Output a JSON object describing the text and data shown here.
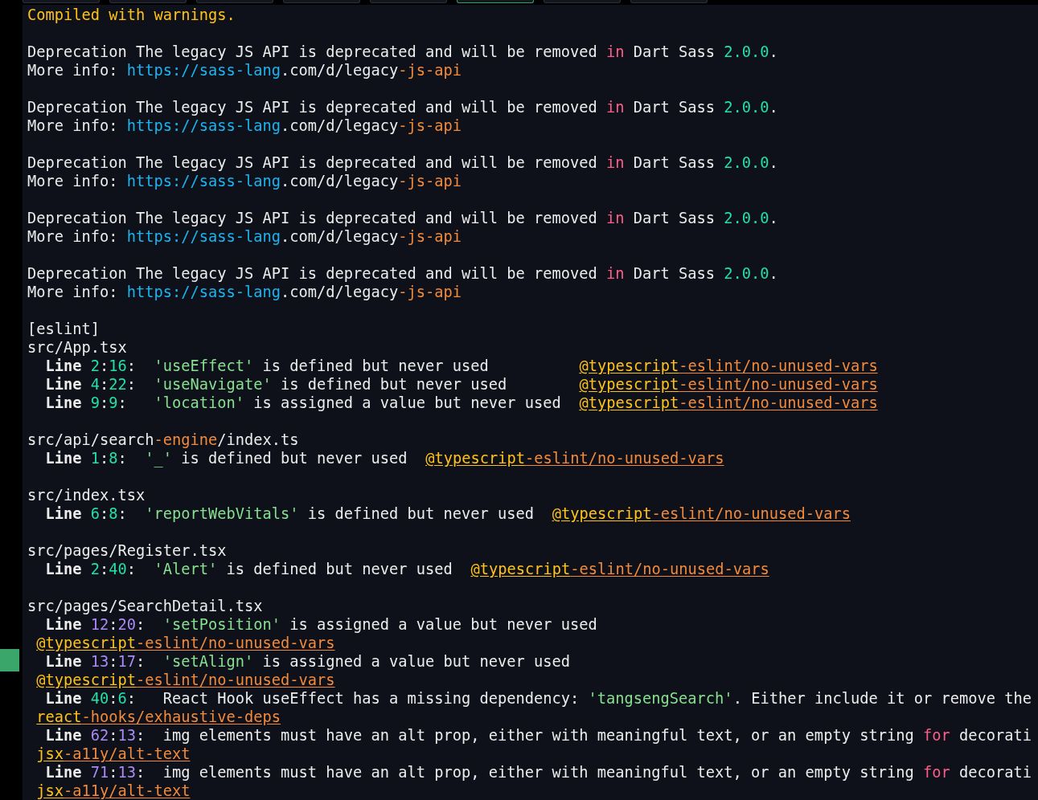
{
  "tabs": [
    {
      "selected": false
    },
    {
      "selected": false
    },
    {
      "selected": false
    },
    {
      "selected": false
    },
    {
      "selected": false
    },
    {
      "selected": true
    },
    {
      "selected": false
    },
    {
      "selected": false
    }
  ],
  "terminal": {
    "lines": [
      {
        "kind": "status",
        "segments": [
          {
            "kind": "warning",
            "text": "Compiled with warnings."
          }
        ]
      },
      {
        "kind": "blank"
      },
      {
        "kind": "log",
        "segments": [
          {
            "kind": "text",
            "text": "Deprecation The legacy JS API is deprecated and will be removed "
          },
          {
            "kind": "keyword",
            "text": "in"
          },
          {
            "kind": "text",
            "text": " Dart Sass "
          },
          {
            "kind": "number",
            "text": "2.0.0"
          },
          {
            "kind": "text",
            "text": "."
          }
        ]
      },
      {
        "kind": "log",
        "segments": [
          {
            "kind": "text",
            "text": "More info: "
          },
          {
            "kind": "url",
            "text": "https://sass-lang"
          },
          {
            "kind": "text",
            "text": ".com/d/legacy"
          },
          {
            "kind": "suffix",
            "text": "-js-api"
          }
        ]
      },
      {
        "kind": "blank"
      },
      {
        "kind": "log",
        "segments": [
          {
            "kind": "text",
            "text": "Deprecation The legacy JS API is deprecated and will be removed "
          },
          {
            "kind": "keyword",
            "text": "in"
          },
          {
            "kind": "text",
            "text": " Dart Sass "
          },
          {
            "kind": "number",
            "text": "2.0.0"
          },
          {
            "kind": "text",
            "text": "."
          }
        ]
      },
      {
        "kind": "log",
        "segments": [
          {
            "kind": "text",
            "text": "More info: "
          },
          {
            "kind": "url",
            "text": "https://sass-lang"
          },
          {
            "kind": "text",
            "text": ".com/d/legacy"
          },
          {
            "kind": "suffix",
            "text": "-js-api"
          }
        ]
      },
      {
        "kind": "blank"
      },
      {
        "kind": "log",
        "segments": [
          {
            "kind": "text",
            "text": "Deprecation The legacy JS API is deprecated and will be removed "
          },
          {
            "kind": "keyword",
            "text": "in"
          },
          {
            "kind": "text",
            "text": " Dart Sass "
          },
          {
            "kind": "number",
            "text": "2.0.0"
          },
          {
            "kind": "text",
            "text": "."
          }
        ]
      },
      {
        "kind": "log",
        "segments": [
          {
            "kind": "text",
            "text": "More info: "
          },
          {
            "kind": "url",
            "text": "https://sass-lang"
          },
          {
            "kind": "text",
            "text": ".com/d/legacy"
          },
          {
            "kind": "suffix",
            "text": "-js-api"
          }
        ]
      },
      {
        "kind": "blank"
      },
      {
        "kind": "log",
        "segments": [
          {
            "kind": "text",
            "text": "Deprecation The legacy JS API is deprecated and will be removed "
          },
          {
            "kind": "keyword",
            "text": "in"
          },
          {
            "kind": "text",
            "text": " Dart Sass "
          },
          {
            "kind": "number",
            "text": "2.0.0"
          },
          {
            "kind": "text",
            "text": "."
          }
        ]
      },
      {
        "kind": "log",
        "segments": [
          {
            "kind": "text",
            "text": "More info: "
          },
          {
            "kind": "url",
            "text": "https://sass-lang"
          },
          {
            "kind": "text",
            "text": ".com/d/legacy"
          },
          {
            "kind": "suffix",
            "text": "-js-api"
          }
        ]
      },
      {
        "kind": "blank"
      },
      {
        "kind": "log",
        "segments": [
          {
            "kind": "text",
            "text": "Deprecation The legacy JS API is deprecated and will be removed "
          },
          {
            "kind": "keyword",
            "text": "in"
          },
          {
            "kind": "text",
            "text": " Dart Sass "
          },
          {
            "kind": "number",
            "text": "2.0.0"
          },
          {
            "kind": "text",
            "text": "."
          }
        ]
      },
      {
        "kind": "log",
        "segments": [
          {
            "kind": "text",
            "text": "More info: "
          },
          {
            "kind": "url",
            "text": "https://sass-lang"
          },
          {
            "kind": "text",
            "text": ".com/d/legacy"
          },
          {
            "kind": "suffix",
            "text": "-js-api"
          }
        ]
      },
      {
        "kind": "blank"
      },
      {
        "kind": "log",
        "segments": [
          {
            "kind": "text",
            "text": "[eslint]"
          }
        ]
      },
      {
        "kind": "file",
        "segments": [
          {
            "kind": "text",
            "text": "src/App.tsx"
          }
        ]
      },
      {
        "kind": "entry",
        "segments": [
          {
            "kind": "label",
            "text": "Line"
          },
          {
            "kind": "number",
            "text": " 2"
          },
          {
            "kind": "text",
            "text": ":"
          },
          {
            "kind": "number",
            "text": "16"
          },
          {
            "kind": "text",
            "text": ":  "
          },
          {
            "kind": "quoted",
            "text": "'useEffect'"
          },
          {
            "kind": "text",
            "text": " is defined but never used          "
          },
          {
            "kind": "link",
            "parts": [
              {
                "kind": "warning",
                "text": "@typescript"
              },
              {
                "kind": "suffix",
                "text": "-eslint/no-unused-vars"
              }
            ]
          }
        ]
      },
      {
        "kind": "entry",
        "segments": [
          {
            "kind": "label",
            "text": "Line"
          },
          {
            "kind": "number",
            "text": " 4"
          },
          {
            "kind": "text",
            "text": ":"
          },
          {
            "kind": "number",
            "text": "22"
          },
          {
            "kind": "text",
            "text": ":  "
          },
          {
            "kind": "quoted",
            "text": "'useNavigate'"
          },
          {
            "kind": "text",
            "text": " is defined but never used        "
          },
          {
            "kind": "link",
            "parts": [
              {
                "kind": "warning",
                "text": "@typescript"
              },
              {
                "kind": "suffix",
                "text": "-eslint/no-unused-vars"
              }
            ]
          }
        ]
      },
      {
        "kind": "entry",
        "segments": [
          {
            "kind": "label",
            "text": "Line"
          },
          {
            "kind": "number",
            "text": " 9"
          },
          {
            "kind": "text",
            "text": ":"
          },
          {
            "kind": "number",
            "text": "9"
          },
          {
            "kind": "text",
            "text": ":   "
          },
          {
            "kind": "quoted",
            "text": "'location'"
          },
          {
            "kind": "text",
            "text": " is assigned a value but never used  "
          },
          {
            "kind": "link",
            "parts": [
              {
                "kind": "warning",
                "text": "@typescript"
              },
              {
                "kind": "suffix",
                "text": "-eslint/no-unused-vars"
              }
            ]
          }
        ]
      },
      {
        "kind": "blank"
      },
      {
        "kind": "file",
        "segments": [
          {
            "kind": "text",
            "text": "src/api/search"
          },
          {
            "kind": "suffix",
            "text": "-engine"
          },
          {
            "kind": "text",
            "text": "/index.ts"
          }
        ]
      },
      {
        "kind": "entry",
        "segments": [
          {
            "kind": "label",
            "text": "Line"
          },
          {
            "kind": "number",
            "text": " 1"
          },
          {
            "kind": "text",
            "text": ":"
          },
          {
            "kind": "number",
            "text": "8"
          },
          {
            "kind": "text",
            "text": ":  "
          },
          {
            "kind": "quoted",
            "text": "'_'"
          },
          {
            "kind": "text",
            "text": " is defined but never used  "
          },
          {
            "kind": "link",
            "parts": [
              {
                "kind": "warning",
                "text": "@typescript"
              },
              {
                "kind": "suffix",
                "text": "-eslint/no-unused-vars"
              }
            ]
          }
        ]
      },
      {
        "kind": "blank"
      },
      {
        "kind": "file",
        "segments": [
          {
            "kind": "text",
            "text": "src/index.tsx"
          }
        ]
      },
      {
        "kind": "entry",
        "segments": [
          {
            "kind": "label",
            "text": "Line"
          },
          {
            "kind": "number",
            "text": " 6"
          },
          {
            "kind": "text",
            "text": ":"
          },
          {
            "kind": "number",
            "text": "8"
          },
          {
            "kind": "text",
            "text": ":  "
          },
          {
            "kind": "quoted",
            "text": "'reportWebVitals'"
          },
          {
            "kind": "text",
            "text": " is defined but never used  "
          },
          {
            "kind": "link",
            "parts": [
              {
                "kind": "warning",
                "text": "@typescript"
              },
              {
                "kind": "suffix",
                "text": "-eslint/no-unused-vars"
              }
            ]
          }
        ]
      },
      {
        "kind": "blank"
      },
      {
        "kind": "file",
        "segments": [
          {
            "kind": "text",
            "text": "src/pages/Register.tsx"
          }
        ]
      },
      {
        "kind": "entry",
        "segments": [
          {
            "kind": "label",
            "text": "Line"
          },
          {
            "kind": "number",
            "text": " 2"
          },
          {
            "kind": "text",
            "text": ":"
          },
          {
            "kind": "number",
            "text": "40"
          },
          {
            "kind": "text",
            "text": ":  "
          },
          {
            "kind": "quoted",
            "text": "'Alert'"
          },
          {
            "kind": "text",
            "text": " is defined but never used  "
          },
          {
            "kind": "link",
            "parts": [
              {
                "kind": "warning",
                "text": "@typescript"
              },
              {
                "kind": "suffix",
                "text": "-eslint/no-unused-vars"
              }
            ]
          }
        ]
      },
      {
        "kind": "blank"
      },
      {
        "kind": "file",
        "segments": [
          {
            "kind": "text",
            "text": "src/pages/SearchDetail.tsx"
          }
        ]
      },
      {
        "kind": "entry",
        "segments": [
          {
            "kind": "label",
            "text": "Line"
          },
          {
            "kind": "position",
            "text": " 12"
          },
          {
            "kind": "text",
            "text": ":"
          },
          {
            "kind": "position",
            "text": "20"
          },
          {
            "kind": "text",
            "text": ":  "
          },
          {
            "kind": "quoted",
            "text": "'setPosition'"
          },
          {
            "kind": "text",
            "text": " is assigned a value but never used"
          }
        ]
      },
      {
        "kind": "rule",
        "segments": [
          {
            "kind": "link",
            "parts": [
              {
                "kind": "warning",
                "text": "@typescript"
              },
              {
                "kind": "suffix",
                "text": "-eslint/no-unused-vars"
              }
            ]
          }
        ]
      },
      {
        "kind": "entry",
        "segments": [
          {
            "kind": "label",
            "text": "Line"
          },
          {
            "kind": "position",
            "text": " 13"
          },
          {
            "kind": "text",
            "text": ":"
          },
          {
            "kind": "position",
            "text": "17"
          },
          {
            "kind": "text",
            "text": ":  "
          },
          {
            "kind": "quoted",
            "text": "'setAlign'"
          },
          {
            "kind": "text",
            "text": " is assigned a value but never used"
          }
        ]
      },
      {
        "kind": "rule",
        "segments": [
          {
            "kind": "link",
            "parts": [
              {
                "kind": "warning",
                "text": "@typescript"
              },
              {
                "kind": "suffix",
                "text": "-eslint/no-unused-vars"
              }
            ]
          }
        ]
      },
      {
        "kind": "entry",
        "segments": [
          {
            "kind": "label",
            "text": "Line"
          },
          {
            "kind": "number",
            "text": " 40"
          },
          {
            "kind": "text",
            "text": ":"
          },
          {
            "kind": "number",
            "text": "6"
          },
          {
            "kind": "text",
            "text": ":   React Hook useEffect has a missing dependency: "
          },
          {
            "kind": "quoted",
            "text": "'tangsengSearch'"
          },
          {
            "kind": "text",
            "text": ". Either include it or remove the"
          }
        ]
      },
      {
        "kind": "rule",
        "segments": [
          {
            "kind": "link",
            "parts": [
              {
                "kind": "warning",
                "text": "react"
              },
              {
                "kind": "suffix",
                "text": "-hooks/exhaustive-deps"
              }
            ]
          }
        ]
      },
      {
        "kind": "entry",
        "segments": [
          {
            "kind": "label",
            "text": "Line"
          },
          {
            "kind": "position",
            "text": " 62"
          },
          {
            "kind": "text",
            "text": ":"
          },
          {
            "kind": "position",
            "text": "13"
          },
          {
            "kind": "text",
            "text": ":  img elements must have an alt prop, either with meaningful text, or an empty string "
          },
          {
            "kind": "keyword",
            "text": "for"
          },
          {
            "kind": "text",
            "text": " decorati"
          }
        ]
      },
      {
        "kind": "rule",
        "segments": [
          {
            "kind": "link",
            "parts": [
              {
                "kind": "warning",
                "text": "jsx"
              },
              {
                "kind": "suffix",
                "text": "-a11y/alt-text"
              }
            ]
          }
        ]
      },
      {
        "kind": "entry",
        "segments": [
          {
            "kind": "label",
            "text": "Line"
          },
          {
            "kind": "position",
            "text": " 71"
          },
          {
            "kind": "text",
            "text": ":"
          },
          {
            "kind": "position",
            "text": "13"
          },
          {
            "kind": "text",
            "text": ":  img elements must have an alt prop, either with meaningful text, or an empty string "
          },
          {
            "kind": "keyword",
            "text": "for"
          },
          {
            "kind": "text",
            "text": " decorati"
          }
        ]
      },
      {
        "kind": "rule",
        "segments": [
          {
            "kind": "link",
            "parts": [
              {
                "kind": "warning",
                "text": "jsx"
              },
              {
                "kind": "suffix",
                "text": "-a11y/alt-text"
              }
            ]
          }
        ]
      }
    ]
  }
}
